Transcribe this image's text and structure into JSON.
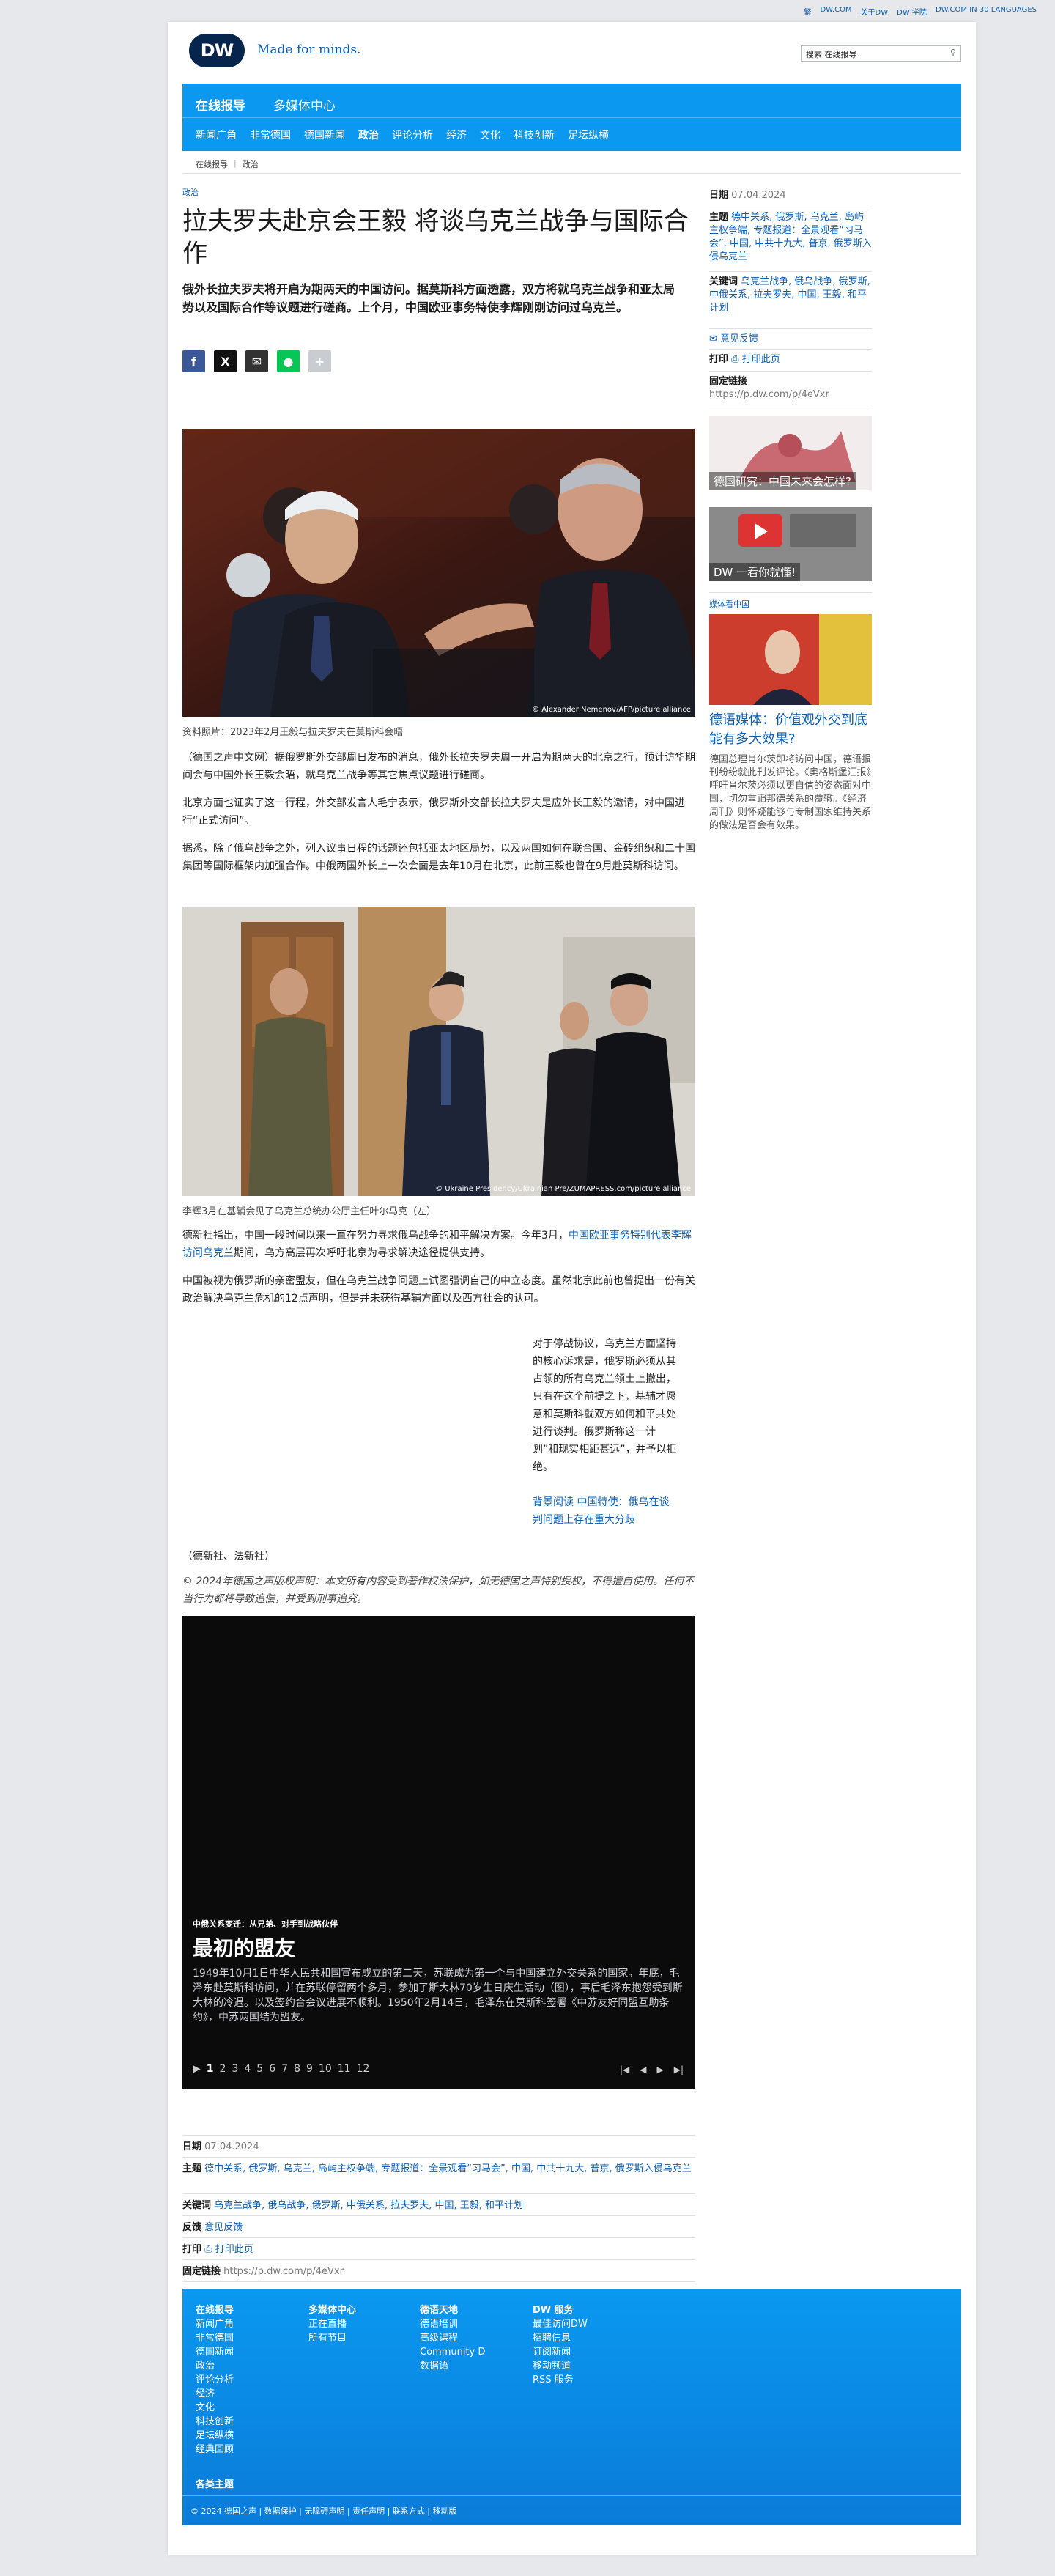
{
  "topbar": {
    "links": [
      "繁",
      "DW.COM",
      "关于DW",
      "DW 学院",
      "DW.COM IN 30 LANGUAGES"
    ]
  },
  "header": {
    "logo": "DW",
    "tagline": "Made for minds.",
    "search_placeholder": "搜索 在线报导"
  },
  "nav": {
    "title": "在线报导",
    "subtitle": "多媒体中心",
    "sections": [
      "新闻广角",
      "非常德国",
      "德国新闻",
      "政治",
      "评论分析",
      "经济",
      "文化",
      "科技创新",
      "足坛纵横"
    ],
    "active": "政治"
  },
  "breadcrumb": [
    "在线报导",
    "政治"
  ],
  "article": {
    "kicker": "政治",
    "title": "拉夫罗夫赴京会王毅 将谈乌克兰战争与国际合作",
    "lead": "俄外长拉夫罗夫将开启为期两天的中国访问。据莫斯科方面透露，双方将就乌克兰战争和亚太局势以及国际合作等议题进行磋商。上个月，中国欧亚事务特使李辉刚刚访问过乌克兰。",
    "share_icons": [
      "facebook-icon",
      "x-icon",
      "mail-icon",
      "line-icon",
      "plus-icon"
    ],
    "image1": {
      "credit": "© Alexander Nemenov/AFP/picture alliance",
      "caption": "资料照片：2023年2月王毅与拉夫罗夫在莫斯科会晤"
    },
    "p1": "（德国之声中文网）据俄罗斯外交部周日发布的消息，俄外长拉夫罗夫周一开启为期两天的北京之行，预计访华期间会与中国外长王毅会晤，就乌克兰战争等其它焦点议题进行磋商。",
    "p2": "北京方面也证实了这一行程，外交部发言人毛宁表示，俄罗斯外交部长拉夫罗夫是应外长王毅的邀请，对中国进行“正式访问”。",
    "p3": "据悉，除了俄乌战争之外，列入议事日程的话题还包括亚太地区局势，以及两国如何在联合国、金砖组织和二十国集团等国际框架内加强合作。中俄两国外长上一次会面是去年10月在北京，此前王毅也曾在9月赴莫斯科访问。",
    "image2": {
      "credit": "© Ukraine Presidency/Ukrainian Pre/ZUMAPRESS.com/picture alliance",
      "caption": "李辉3月在基辅会见了乌克兰总统办公厅主任叶尔马克（左）"
    },
    "p4_a": "德新社指出，中国一段时间以来一直在努力寻求俄乌战争的和平解决方案。今年3月，",
    "p4_link": "中国欧亚事务特别代表李辉访问乌克兰",
    "p4_b": "期间，乌方高层再次呼吁北京为寻求解决途径提供支持。",
    "p5": "中国被视为俄罗斯的亲密盟友，但在乌克兰战争问题上试图强调自己的中立态度。虽然北京此前也曾提出一份有关政治解决乌克兰危机的12点声明，但是并未获得基辅方面以及西方社会的认可。",
    "p6": "对于停战协议，乌克兰方面坚持的核心诉求是，俄罗斯必须从其占领的所有乌克兰领土上撤出，只有在这个前提之下，基辅才愿意和莫斯科就双方如何和平共处进行谈判。俄罗斯称这一计划”和现实相距甚远”，并予以拒绝。",
    "p6_link": "背景阅读 中国特使：俄乌在谈判问题上存在重大分歧",
    "source": "（德新社、法新社）",
    "copyright": "© 2024年德国之声版权声明：本文所有内容受到著作权法保护，如无德国之声特别授权，不得擅自使用。任何不当行为都将导致追偿，并受到刑事追究。"
  },
  "gallery": {
    "label": "中俄关系变迁：从兄弟、对手到战略伙伴",
    "title": "最初的盟友",
    "text": "1949年10月1日中华人民共和国宣布成立的第二天，苏联成为第一个与中国建立外交关系的国家。年底，毛泽东赴莫斯科访问，并在苏联停留两个多月，参加了斯大林70岁生日庆生活动（图），事后毛泽东抱怨受到斯大林的冷遇。以及签约合会议进展不顺利。1950年2月14日，毛泽东在莫斯科签署《中苏友好同盟互助条约》，中苏两国结为盟友。",
    "pages": [
      "1",
      "2",
      "3",
      "4",
      "5",
      "6",
      "7",
      "8",
      "9",
      "10",
      "11",
      "12"
    ],
    "current": "1"
  },
  "meta": {
    "date_label": "日期",
    "date": "07.04.2024",
    "topics_label": "主题",
    "topics": "德中关系, 俄罗斯, 乌克兰, 岛屿主权争端, 专题报道：全景观看“习马会”, 中国, 中共十九大, 普京, 俄罗斯入侵乌克兰",
    "keywords_label": "关键词",
    "keywords": "乌克兰战争, 俄乌战争, 俄罗斯, 中俄关系, 拉夫罗夫, 中国, 王毅, 和平计划",
    "feedback_label": "反馈",
    "feedback": "意见反馈",
    "print_label": "打印",
    "print": "打印此页",
    "permalink_label": "固定链接",
    "permalink": "https://p.dw.com/p/4eVxr"
  },
  "sidebar": {
    "date_label": "日期",
    "date": "07.04.2024",
    "topics_label": "主题",
    "topics": "德中关系, 俄罗斯, 乌克兰, 岛屿主权争端, 专题报道：全景观看“习马会”, 中国, 中共十九大, 普京, 俄罗斯入侵乌克兰",
    "keywords_label": "关键词",
    "keywords": "乌克兰战争, 俄乌战争, 俄罗斯, 中俄关系, 拉夫罗夫, 中国, 王毅, 和平计划",
    "feedback": "意见反馈",
    "print_label": "打印",
    "print": "打印此页",
    "permalink_label": "固定链接",
    "permalink": "https://p.dw.com/p/4eVxr",
    "card1": "德国研究：中国未来会怎样?",
    "card2": "DW 一看你就懂!",
    "media_label": "媒体看中国",
    "story_title": "德语媒体：价值观外交到底能有多大效果?",
    "story_text": "德国总理肖尔茨即将访问中国，德语报刊纷纷就此刊发评论。《奥格斯堡汇报》呼吁肖尔茨必须以更自信的姿态面对中国，切勿重蹈邦德关系的覆辙。《经济周刊》则怀疑能够与专制国家维持关系的做法是否会有效果。"
  },
  "footer": {
    "col1_head": "在线报导",
    "col1": [
      "新闻广角",
      "非常德国",
      "德国新闻",
      "政治",
      "评论分析",
      "经济",
      "文化",
      "科技创新",
      "足坛纵横",
      "经典回顾"
    ],
    "col2_head": "多媒体中心",
    "col2": [
      "正在直播",
      "所有节目"
    ],
    "col3_head": "德语天地",
    "col3": [
      "德语培训",
      "高级课程",
      "Community D",
      "数据语"
    ],
    "col4_head": "DW 服务",
    "col4": [
      "最佳访问DW",
      "招聘信息",
      "订阅新闻",
      "移动频道",
      "RSS 服务"
    ],
    "topics": "各类主题",
    "bottom": "© 2024 德国之声 | 数据保护 | 无障碍声明 | 责任声明 | 联系方式 | 移动版"
  },
  "colors": {
    "brand_blue": "#0a98f0",
    "link": "#0a5eb3",
    "logo_navy": "#05254d"
  }
}
